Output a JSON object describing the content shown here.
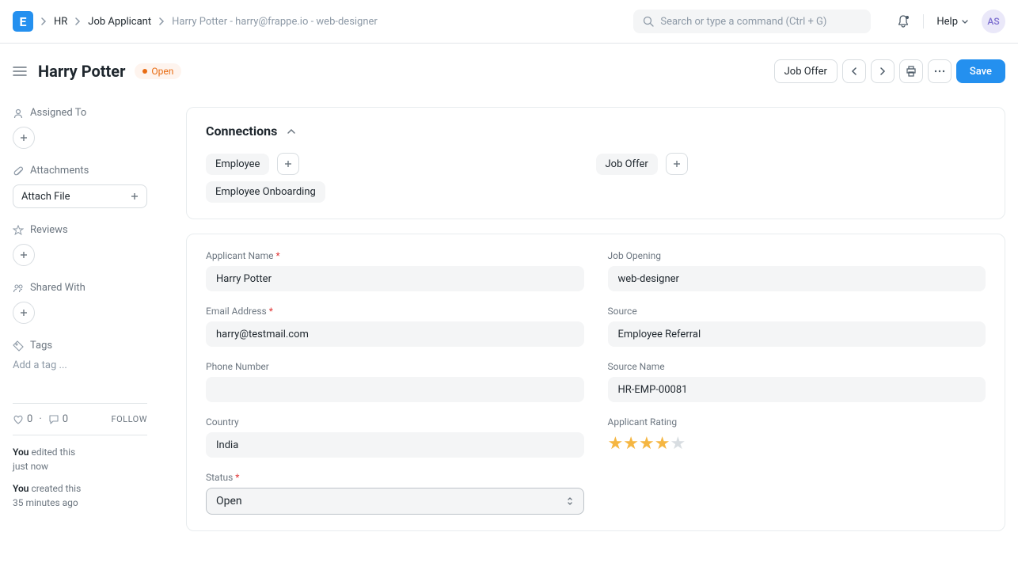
{
  "navbar": {
    "logo_letter": "E",
    "breadcrumb": {
      "root": "HR",
      "doctype": "Job Applicant",
      "current": "Harry Potter - harry@frappe.io - web-designer"
    },
    "search_placeholder": "Search or type a command (Ctrl + G)",
    "help_label": "Help",
    "avatar_initials": "AS"
  },
  "header": {
    "title": "Harry Potter",
    "status_label": "Open",
    "job_offer_btn": "Job Offer",
    "save_btn": "Save"
  },
  "sidebar": {
    "assigned_to": "Assigned To",
    "attachments": "Attachments",
    "attach_file": "Attach File",
    "reviews": "Reviews",
    "shared_with": "Shared With",
    "tags": "Tags",
    "add_tag": "Add a tag ...",
    "likes": "0",
    "comments": "0",
    "follow": "FOLLOW",
    "activity1_who": "You",
    "activity1_text": "edited this",
    "activity1_time": "just now",
    "activity2_who": "You",
    "activity2_text": "created this",
    "activity2_time": "35 minutes ago"
  },
  "connections": {
    "title": "Connections",
    "employee": "Employee",
    "job_offer": "Job Offer",
    "employee_onboarding": "Employee Onboarding"
  },
  "form": {
    "applicant_name": {
      "label": "Applicant Name",
      "value": "Harry Potter"
    },
    "job_opening": {
      "label": "Job Opening",
      "value": "web-designer"
    },
    "email": {
      "label": "Email Address",
      "value": "harry@testmail.com"
    },
    "source": {
      "label": "Source",
      "value": "Employee Referral"
    },
    "phone": {
      "label": "Phone Number",
      "value": ""
    },
    "source_name": {
      "label": "Source Name",
      "value": "HR-EMP-00081"
    },
    "country": {
      "label": "Country",
      "value": "India"
    },
    "rating": {
      "label": "Applicant Rating",
      "value": 4,
      "max": 5
    },
    "status": {
      "label": "Status",
      "value": "Open"
    }
  }
}
